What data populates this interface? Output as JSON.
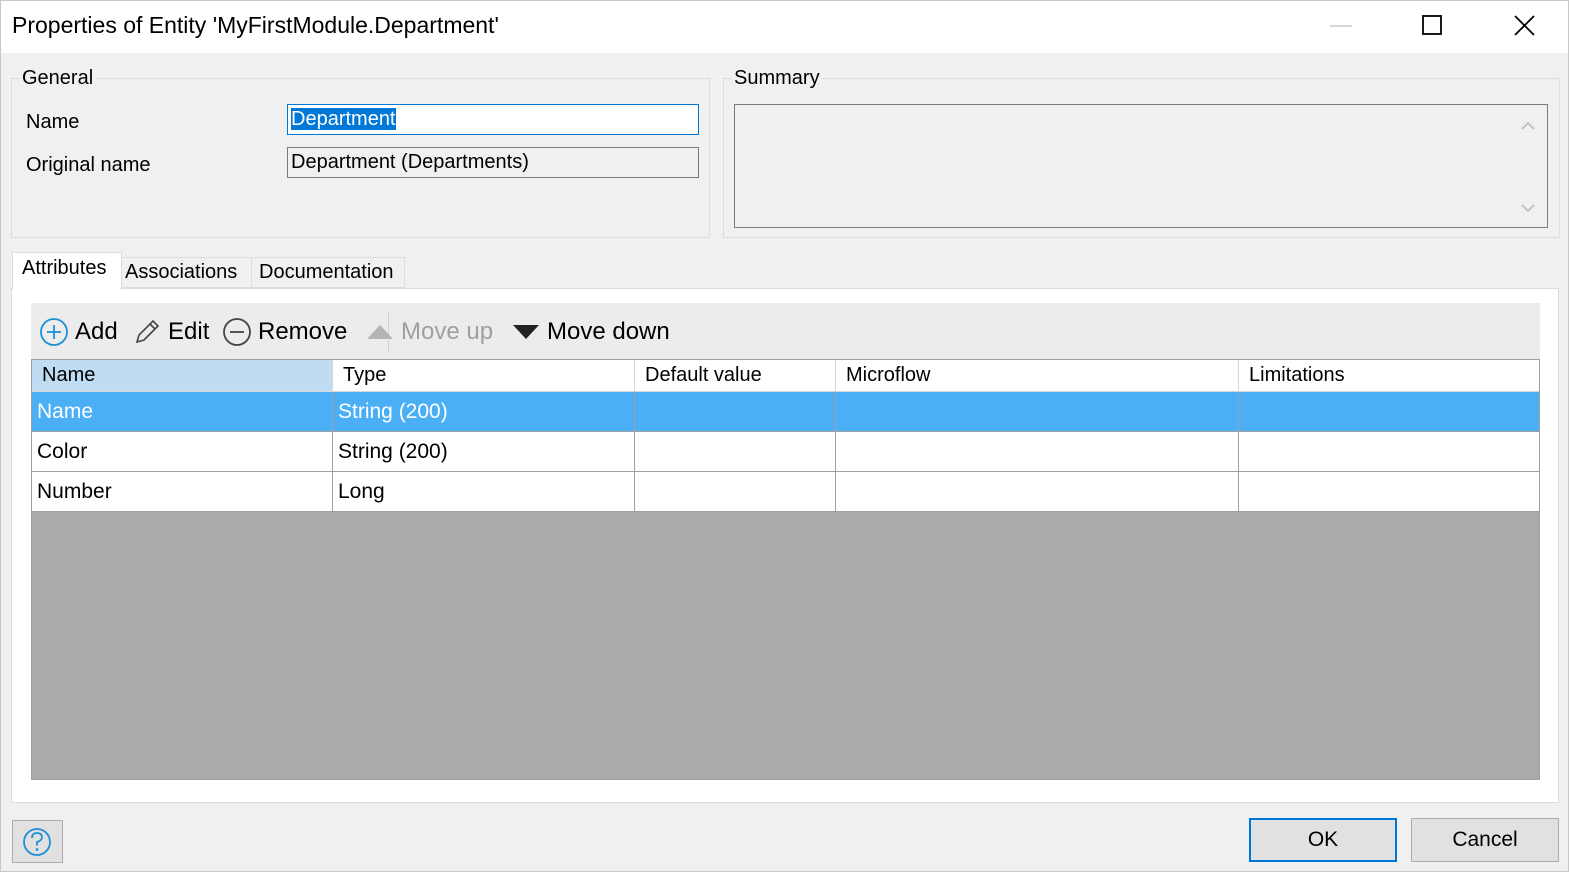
{
  "window": {
    "title": "Properties of Entity 'MyFirstModule.Department'"
  },
  "general": {
    "legend": "General",
    "name_label": "Name",
    "name_value": "Department",
    "original_name_label": "Original name",
    "original_name_value": "Department (Departments)"
  },
  "summary": {
    "legend": "Summary",
    "text": ""
  },
  "tabs": [
    {
      "label": "Attributes",
      "active": true
    },
    {
      "label": "Associations",
      "active": false
    },
    {
      "label": "Documentation",
      "active": false
    }
  ],
  "toolbar": {
    "add_label": "Add",
    "edit_label": "Edit",
    "remove_label": "Remove",
    "move_up_label": "Move up",
    "move_down_label": "Move down"
  },
  "attributes_table": {
    "columns": [
      "Name",
      "Type",
      "Default value",
      "Microflow",
      "Limitations"
    ],
    "rows": [
      [
        "Name",
        "String (200)",
        "",
        "",
        ""
      ],
      [
        "Color",
        "String (200)",
        "",
        "",
        ""
      ],
      [
        "Number",
        "Long",
        "",
        "",
        ""
      ]
    ],
    "selected_row": 0
  },
  "footer": {
    "ok_label": "OK",
    "cancel_label": "Cancel"
  },
  "colors": {
    "accent": "#0078d7",
    "selected_row": "#4aaff5",
    "active_header": "#bfdcf2",
    "empty_grid": "#ababab",
    "help_icon": "#1e90d6"
  },
  "icons": {
    "add": "plus-circle-icon",
    "edit": "pencil-icon",
    "remove": "minus-circle-icon",
    "move_up": "triangle-up-icon",
    "move_down": "triangle-down-icon",
    "help": "question-icon"
  }
}
